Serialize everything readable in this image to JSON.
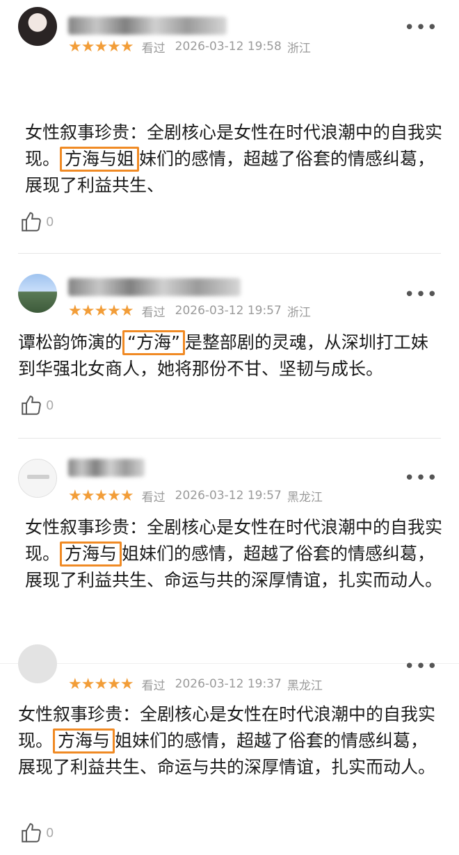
{
  "reviews": [
    {
      "stars": "★★★★★",
      "seen_label": "看过",
      "datetime": "2026-03-12 19:58",
      "location": "浙江",
      "text_before": "女性叙事珍贵：全剧核心是女性在时代浪潮中的自我实现。",
      "highlight": "方海与姐",
      "text_after": "妹们的感情，超越了俗套的情感纠葛，展现了利益共生、",
      "like_count": "0"
    },
    {
      "stars": "★★★★★",
      "seen_label": "看过",
      "datetime": "2026-03-12 19:57",
      "location": "浙江",
      "text_before": "谭松韵饰演的",
      "highlight": "“方海”",
      "text_after": "是整部剧的灵魂，从深圳打工妹到华强北女商人，她将那份不甘、坚韧与成长。",
      "like_count": "0"
    },
    {
      "stars": "★★★★★",
      "seen_label": "看过",
      "datetime": "2026-03-12 19:57",
      "location": "黑龙江",
      "text_before": "女性叙事珍贵：全剧核心是女性在时代浪潮中的自我实现。",
      "highlight": "方海与",
      "text_after": "姐妹们的感情，超越了俗套的情感纠葛，展现了利益共生、命运与共的深厚情谊，扎实而动人。"
    },
    {
      "stars": "★★★★★",
      "seen_label": "看过",
      "datetime": "2026-03-12 19:37",
      "location": "黑龙江",
      "text_before": "女性叙事珍贵：全剧核心是女性在时代浪潮中的自我实现。",
      "highlight": "方海与",
      "text_after": "姐妹们的感情，超越了俗套的情感纠葛，展现了利益共生、命运与共的深厚情谊，扎实而动人。",
      "like_count": "0"
    }
  ],
  "colors": {
    "accent": "#f08a24",
    "star": "#f29d38",
    "meta": "#9a9a9a"
  },
  "icons": {
    "more": "more-dots-icon",
    "like": "thumbs-up-icon"
  }
}
